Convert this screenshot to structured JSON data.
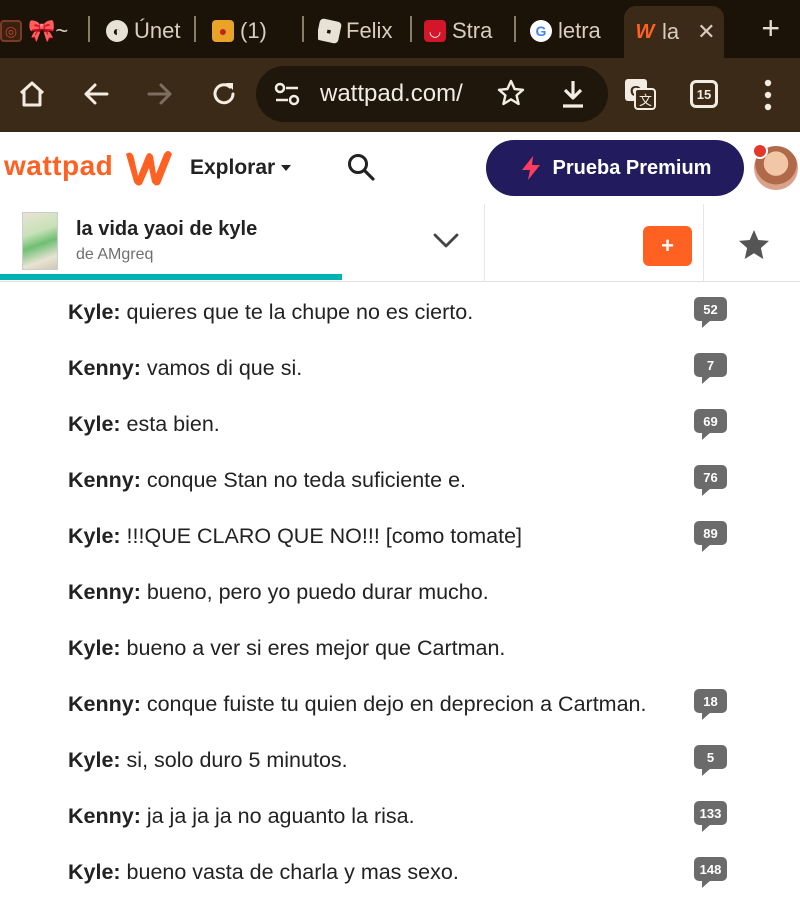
{
  "browser": {
    "tabs": [
      {
        "label": "🎀~",
        "favicon": "instagram-icon",
        "active": false
      },
      {
        "label": "Únet",
        "favicon": "globe-icon",
        "active": false
      },
      {
        "label": "(1)",
        "favicon": "apple-icon",
        "active": false
      },
      {
        "label": "Felix",
        "favicon": "roblox-icon",
        "active": false
      },
      {
        "label": "Stra",
        "favicon": "stray-icon",
        "active": false
      },
      {
        "label": "letra",
        "favicon": "google-icon",
        "active": false
      },
      {
        "label": "la",
        "favicon": "wattpad-icon",
        "active": true
      }
    ],
    "new_tab_label": "+",
    "close_tab_label": "✕",
    "url": "wattpad.com/",
    "tabs_count": "15"
  },
  "header": {
    "logo_text": "wattpad",
    "explore_label": "Explorar",
    "premium_label": "Prueba Premium",
    "brand_color": "#ff6122",
    "premium_color": "#221c5e"
  },
  "story": {
    "title": "la vida yaoi de kyle",
    "author": "de AMgreq",
    "add_label": "+",
    "reading_progress": 0.427,
    "progress_color": "#00b2b2"
  },
  "content": {
    "lines": [
      {
        "speaker": "Kyle:",
        "text": " quieres que te la chupe no es cierto.",
        "comments": "52"
      },
      {
        "speaker": "Kenny:",
        "text": " vamos di que si.",
        "comments": "7"
      },
      {
        "speaker": "Kyle:",
        "text": " esta bien.",
        "comments": "69"
      },
      {
        "speaker": "Kenny:",
        "text": " conque Stan no teda suficiente e.",
        "comments": "76"
      },
      {
        "speaker": "Kyle:",
        "text": " !!!QUE CLARO QUE NO!!! [como tomate]",
        "comments": "89"
      },
      {
        "speaker": "Kenny:",
        "text": " bueno, pero yo puedo durar mucho.",
        "comments": ""
      },
      {
        "speaker": "Kyle:",
        "text": " bueno a ver si eres mejor que Cartman.",
        "comments": ""
      },
      {
        "speaker": "Kenny:",
        "text": " conque fuiste tu quien dejo en deprecion a Cartman.",
        "comments": "18"
      },
      {
        "speaker": "Kyle:",
        "text": " si, solo duro 5 minutos.",
        "comments": "5"
      },
      {
        "speaker": "Kenny:",
        "text": " ja ja ja ja no aguanto la risa.",
        "comments": "133"
      },
      {
        "speaker": "Kyle:",
        "text": " bueno vasta de charla y mas sexo.",
        "comments": "148"
      }
    ]
  }
}
